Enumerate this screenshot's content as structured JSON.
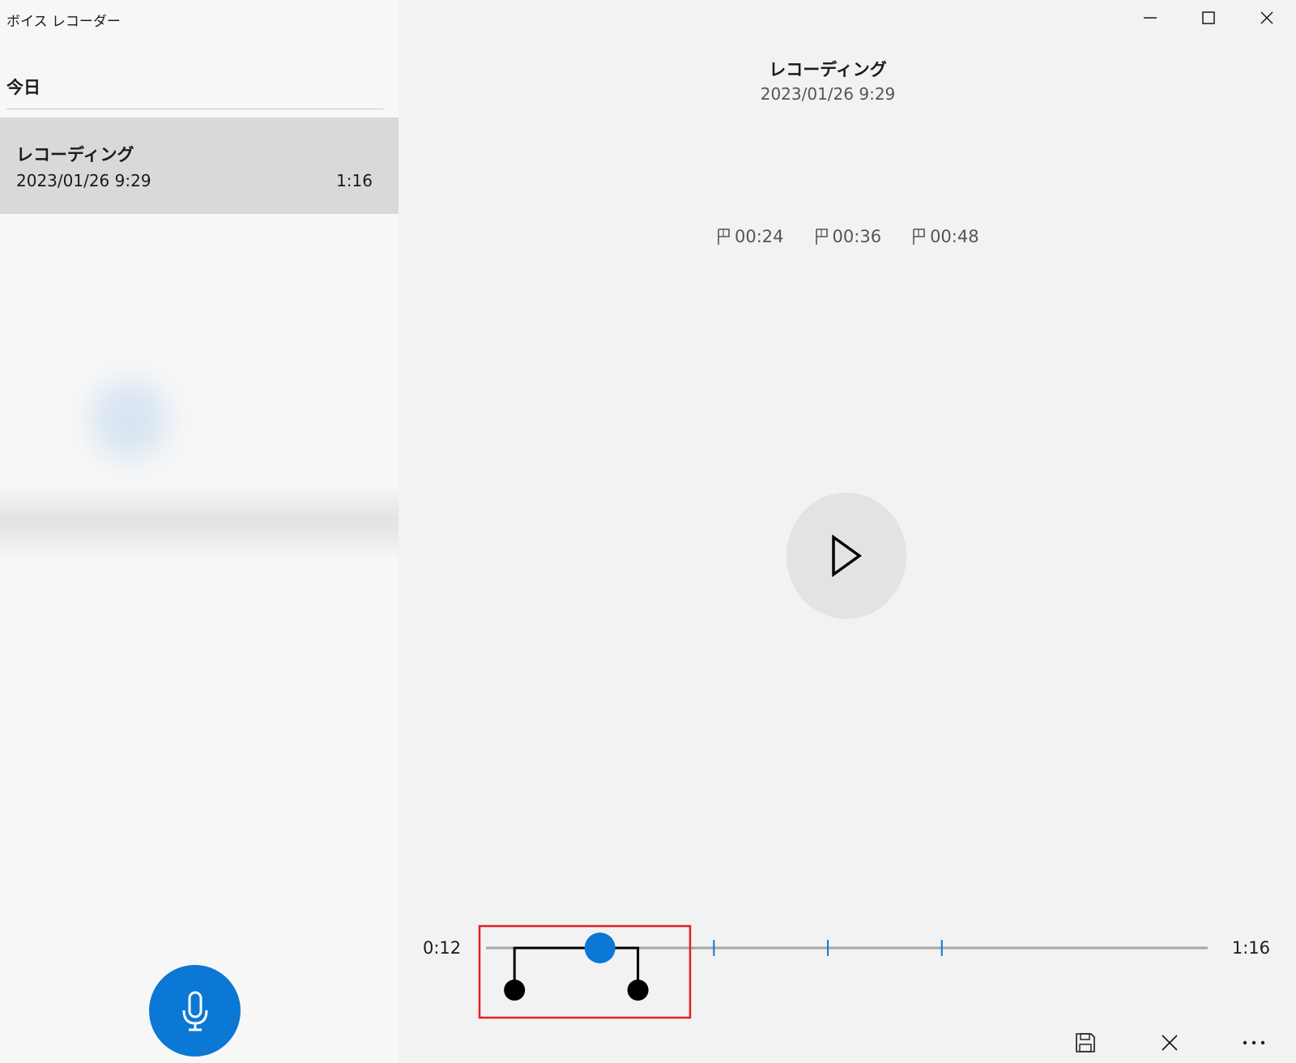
{
  "app": {
    "title": "ボイス レコーダー"
  },
  "list": {
    "group_header": "今日",
    "items": [
      {
        "name": "レコーディング",
        "date": "2023/01/26 9:29",
        "duration": "1:16"
      }
    ]
  },
  "detail": {
    "title": "レコーディング",
    "date": "2023/01/26 9:29",
    "markers": [
      {
        "label": "00:24"
      },
      {
        "label": "00:36"
      },
      {
        "label": "00:48"
      }
    ],
    "current_time": "0:12",
    "total_time": "1:16"
  },
  "timeline": {
    "total_seconds": 76,
    "position_seconds": 12,
    "trim_start_seconds": 3,
    "trim_end_seconds": 16,
    "marker_seconds": [
      24,
      36,
      48
    ]
  },
  "colors": {
    "accent": "#0a78d4",
    "highlight_box": "#e02020",
    "selected_item": "#d9d9d9",
    "track": "#a6a6a6"
  },
  "icons": {
    "record": "microphone-icon",
    "play": "play-icon",
    "marker": "flag-icon",
    "save": "save-icon",
    "discard": "close-icon",
    "more": "more-icon"
  }
}
